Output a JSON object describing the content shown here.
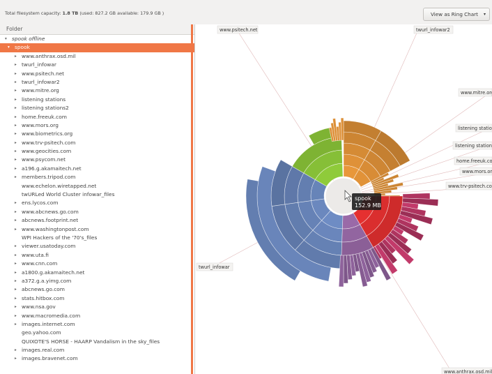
{
  "topbar": {
    "capacity_prefix": "Total filesystem capacity: ",
    "capacity_value": "1.8 TB",
    "capacity_suffix": " (used: 827.2 GB available: 179.9 GB )",
    "view_combo_label": "View as Ring Chart",
    "view_combo_arrow": "▾"
  },
  "tree": {
    "header": "Folder",
    "rows": [
      {
        "label": "spook offline",
        "expander": "▾",
        "depth": 0,
        "italic": true
      },
      {
        "label": "spook",
        "expander": "▾",
        "depth": 1,
        "selected": true
      },
      {
        "label": "www.anthrax.osd.mil",
        "expander": "▸",
        "depth": 2
      },
      {
        "label": "twurl_infowar",
        "expander": "▸",
        "depth": 2
      },
      {
        "label": "www.psitech.net",
        "expander": "▸",
        "depth": 2
      },
      {
        "label": "twurl_infowar2",
        "expander": "▸",
        "depth": 2
      },
      {
        "label": "www.mitre.org",
        "expander": "▸",
        "depth": 2
      },
      {
        "label": "listening stations",
        "expander": "▸",
        "depth": 2
      },
      {
        "label": "listening stations2",
        "expander": "▸",
        "depth": 2
      },
      {
        "label": "home.freeuk.com",
        "expander": "▸",
        "depth": 2
      },
      {
        "label": "www.mors.org",
        "expander": "▸",
        "depth": 2
      },
      {
        "label": "www.biometrics.org",
        "expander": "▸",
        "depth": 2
      },
      {
        "label": "www.trv-psitech.com",
        "expander": "▸",
        "depth": 2
      },
      {
        "label": "www.geocities.com",
        "expander": "▸",
        "depth": 2
      },
      {
        "label": "www.psycom.net",
        "expander": "▸",
        "depth": 2
      },
      {
        "label": "a196.g.akamaitech.net",
        "expander": "▸",
        "depth": 2
      },
      {
        "label": "members.tripod.com",
        "expander": "▸",
        "depth": 2
      },
      {
        "label": "www.echelon.wiretapped.net",
        "expander": "",
        "depth": 2
      },
      {
        "label": "twURLed World Cluster infowar_files",
        "expander": "",
        "depth": 2
      },
      {
        "label": "ens.lycos.com",
        "expander": "▸",
        "depth": 2
      },
      {
        "label": "www.abcnews.go.com",
        "expander": "▸",
        "depth": 2
      },
      {
        "label": "abcnews.footprint.net",
        "expander": "▸",
        "depth": 2
      },
      {
        "label": "www.washingtonpost.com",
        "expander": "▸",
        "depth": 2
      },
      {
        "label": "WPI Hackers of the '70's_files",
        "expander": "",
        "depth": 2
      },
      {
        "label": "viewer.usatoday.com",
        "expander": "▸",
        "depth": 2
      },
      {
        "label": "www.uta.fi",
        "expander": "▸",
        "depth": 2
      },
      {
        "label": "www.cnn.com",
        "expander": "▸",
        "depth": 2
      },
      {
        "label": "a1800.g.akamaitech.net",
        "expander": "▸",
        "depth": 2
      },
      {
        "label": "a372.g.a.yimg.com",
        "expander": "▸",
        "depth": 2
      },
      {
        "label": "abcnews.go.com",
        "expander": "▸",
        "depth": 2
      },
      {
        "label": "stats.hitbox.com",
        "expander": "▸",
        "depth": 2
      },
      {
        "label": "www.nsa.gov",
        "expander": "▸",
        "depth": 2
      },
      {
        "label": "www.macromedia.com",
        "expander": "▸",
        "depth": 2
      },
      {
        "label": "images.internet.com",
        "expander": "▸",
        "depth": 2
      },
      {
        "label": "geo.yahoo.com",
        "expander": "",
        "depth": 2
      },
      {
        "label": "QUIXOTE'S HORSE - HAARP Vandalism in the sky_files",
        "expander": "",
        "depth": 2
      },
      {
        "label": "images.real.com",
        "expander": "▸",
        "depth": 2
      },
      {
        "label": "images.bravenet.com",
        "expander": "▸",
        "depth": 2
      }
    ]
  },
  "ring": {
    "tooltip_name": "spook",
    "tooltip_size": "152.9 MB",
    "colors": {
      "blue": "#6e8cc4",
      "green": "#8fcb3a",
      "orange": "#e8973a",
      "red": "#e53030",
      "magenta": "#c23a6a",
      "purple": "#9a6aa8",
      "accent": "#f07746"
    },
    "labels": [
      "www.psitech.net",
      "twurl_infowar2",
      "www.mitre.org",
      "listening station",
      "listening stations",
      "home.freeuk.con",
      "www.mors.or",
      "www.trv-psitech.com",
      "twurl_infowar",
      "www.anthrax.osd.mil"
    ]
  }
}
